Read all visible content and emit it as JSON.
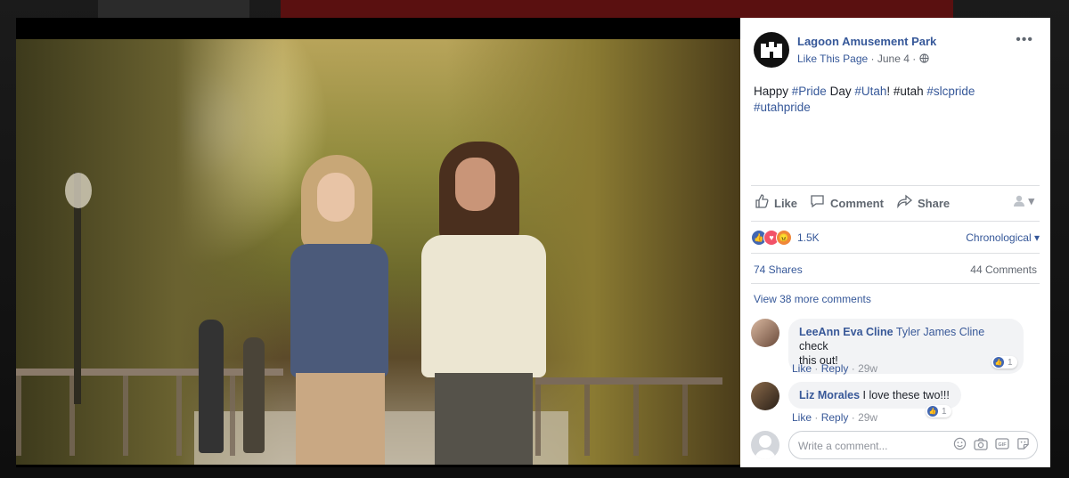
{
  "post": {
    "page_name": "Lagoon Amusement Park",
    "like_page": "Like This Page",
    "date": "June 4",
    "separator": "·",
    "audience_icon": "globe-icon",
    "text_parts": [
      "Happy ",
      "#Pride",
      " Day ",
      "#Utah",
      "! #utah ",
      "#slcpride",
      " ",
      "#utahpride"
    ]
  },
  "actions": {
    "like": "Like",
    "comment": "Comment",
    "share": "Share"
  },
  "stats": {
    "reactions_count": "1.5K",
    "sort_label": "Chronological",
    "shares": "74 Shares",
    "comments": "44 Comments",
    "more_comments": "View 38 more comments"
  },
  "comments": [
    {
      "author": "LeeAnn Eva Cline",
      "mention": "Tyler James Cline",
      "text_line1": " check",
      "text_line2": "this out!",
      "like": "Like",
      "reply": "Reply",
      "time": "29w",
      "reactions": "1"
    },
    {
      "author": "Liz Morales",
      "text": " I love these two!!!",
      "like": "Like",
      "reply": "Reply",
      "time": "29w",
      "reactions": "1"
    }
  ],
  "composer": {
    "placeholder": "Write a comment..."
  },
  "colors": {
    "link": "#365899",
    "like_reaction": "#4267b2",
    "love_reaction": "#f25268",
    "angry_reaction": "#f0873a"
  }
}
